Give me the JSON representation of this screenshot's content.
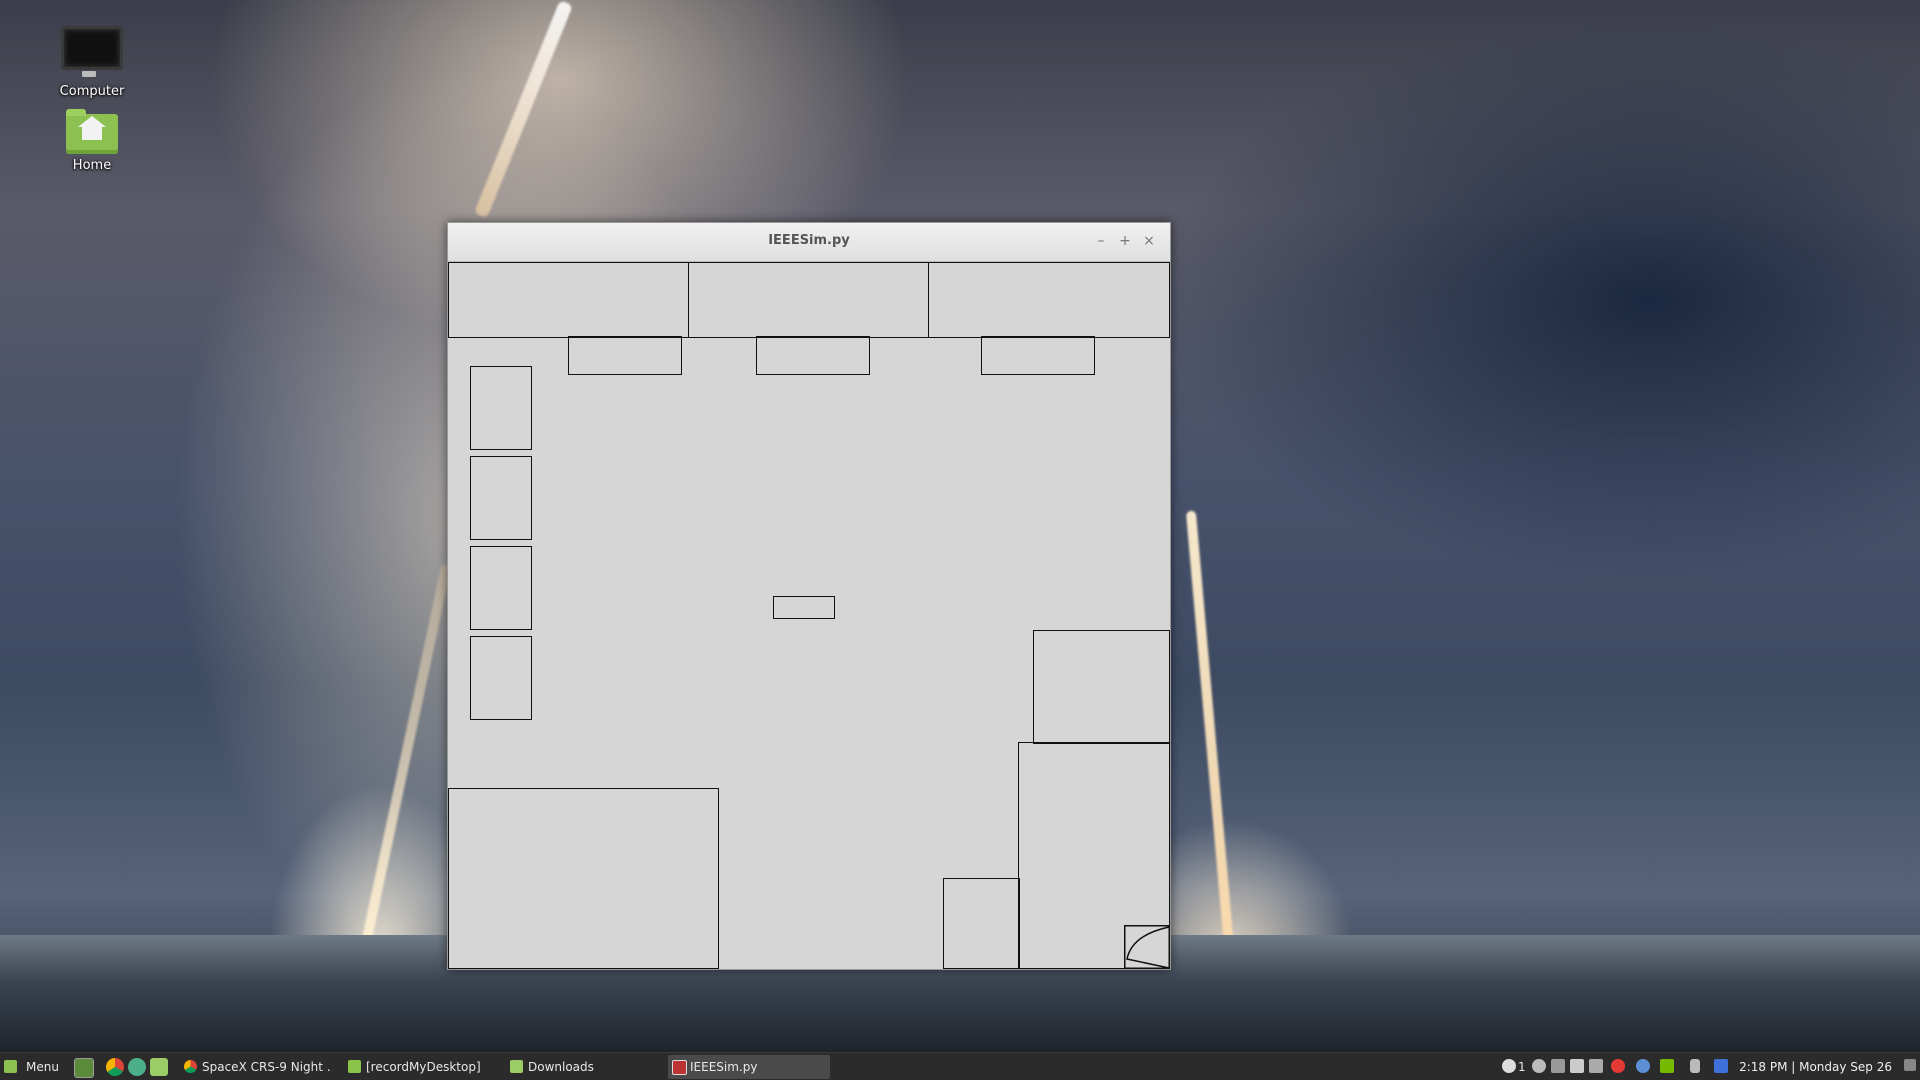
{
  "desktop": {
    "icons": [
      {
        "label": "Computer",
        "icon": "computer-icon"
      },
      {
        "label": "Home",
        "icon": "home-folder-icon"
      }
    ]
  },
  "window": {
    "title": "IEEESim.py",
    "controls": {
      "minimize": "–",
      "maximize": "+",
      "close": "×"
    }
  },
  "taskbar": {
    "menu_label": "Menu",
    "quick_launch": [
      "show-desktop-icon",
      "chrome-icon",
      "browser-icon",
      "files-icon"
    ],
    "tasks": [
      {
        "label": "SpaceX CRS-9 Night ...",
        "icon": "chrome-icon",
        "active": false
      },
      {
        "label": "[recordMyDesktop]",
        "icon": "app-icon",
        "active": false
      },
      {
        "label": "Downloads",
        "icon": "folder-icon",
        "active": false
      },
      {
        "label": "IEEESim.py",
        "icon": "python-window-icon",
        "active": true
      }
    ],
    "tray": {
      "notification_count": "1",
      "icons": [
        "info-icon",
        "user-icon",
        "network-icon",
        "volume-icon",
        "power-icon",
        "record-icon",
        "shield-icon",
        "nvidia-icon",
        "bluetooth-icon",
        "lock-icon"
      ]
    },
    "clock": "2:18 PM | Monday Sep 26"
  }
}
